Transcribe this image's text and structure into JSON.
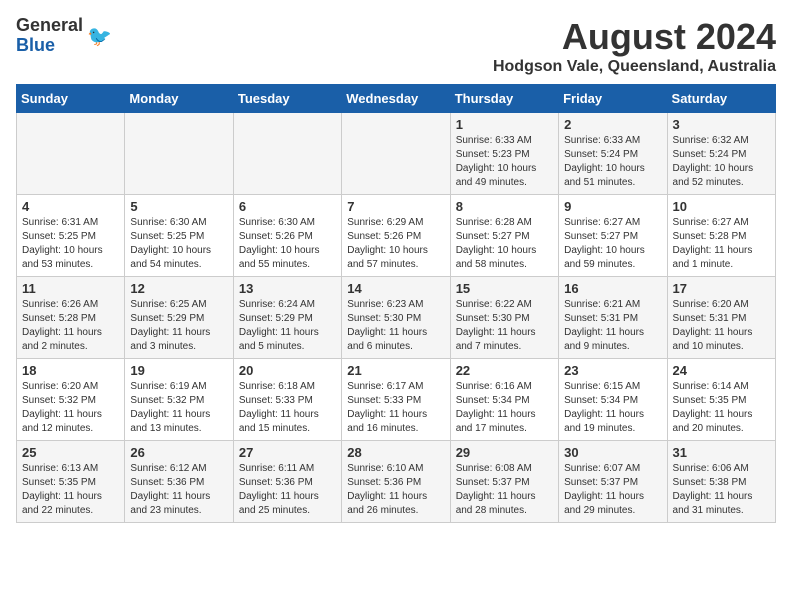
{
  "logo": {
    "general": "General",
    "blue": "Blue"
  },
  "title": "August 2024",
  "subtitle": "Hodgson Vale, Queensland, Australia",
  "days_of_week": [
    "Sunday",
    "Monday",
    "Tuesday",
    "Wednesday",
    "Thursday",
    "Friday",
    "Saturday"
  ],
  "weeks": [
    [
      {
        "day": "",
        "info": ""
      },
      {
        "day": "",
        "info": ""
      },
      {
        "day": "",
        "info": ""
      },
      {
        "day": "",
        "info": ""
      },
      {
        "day": "1",
        "info": "Sunrise: 6:33 AM\nSunset: 5:23 PM\nDaylight: 10 hours\nand 49 minutes."
      },
      {
        "day": "2",
        "info": "Sunrise: 6:33 AM\nSunset: 5:24 PM\nDaylight: 10 hours\nand 51 minutes."
      },
      {
        "day": "3",
        "info": "Sunrise: 6:32 AM\nSunset: 5:24 PM\nDaylight: 10 hours\nand 52 minutes."
      }
    ],
    [
      {
        "day": "4",
        "info": "Sunrise: 6:31 AM\nSunset: 5:25 PM\nDaylight: 10 hours\nand 53 minutes."
      },
      {
        "day": "5",
        "info": "Sunrise: 6:30 AM\nSunset: 5:25 PM\nDaylight: 10 hours\nand 54 minutes."
      },
      {
        "day": "6",
        "info": "Sunrise: 6:30 AM\nSunset: 5:26 PM\nDaylight: 10 hours\nand 55 minutes."
      },
      {
        "day": "7",
        "info": "Sunrise: 6:29 AM\nSunset: 5:26 PM\nDaylight: 10 hours\nand 57 minutes."
      },
      {
        "day": "8",
        "info": "Sunrise: 6:28 AM\nSunset: 5:27 PM\nDaylight: 10 hours\nand 58 minutes."
      },
      {
        "day": "9",
        "info": "Sunrise: 6:27 AM\nSunset: 5:27 PM\nDaylight: 10 hours\nand 59 minutes."
      },
      {
        "day": "10",
        "info": "Sunrise: 6:27 AM\nSunset: 5:28 PM\nDaylight: 11 hours\nand 1 minute."
      }
    ],
    [
      {
        "day": "11",
        "info": "Sunrise: 6:26 AM\nSunset: 5:28 PM\nDaylight: 11 hours\nand 2 minutes."
      },
      {
        "day": "12",
        "info": "Sunrise: 6:25 AM\nSunset: 5:29 PM\nDaylight: 11 hours\nand 3 minutes."
      },
      {
        "day": "13",
        "info": "Sunrise: 6:24 AM\nSunset: 5:29 PM\nDaylight: 11 hours\nand 5 minutes."
      },
      {
        "day": "14",
        "info": "Sunrise: 6:23 AM\nSunset: 5:30 PM\nDaylight: 11 hours\nand 6 minutes."
      },
      {
        "day": "15",
        "info": "Sunrise: 6:22 AM\nSunset: 5:30 PM\nDaylight: 11 hours\nand 7 minutes."
      },
      {
        "day": "16",
        "info": "Sunrise: 6:21 AM\nSunset: 5:31 PM\nDaylight: 11 hours\nand 9 minutes."
      },
      {
        "day": "17",
        "info": "Sunrise: 6:20 AM\nSunset: 5:31 PM\nDaylight: 11 hours\nand 10 minutes."
      }
    ],
    [
      {
        "day": "18",
        "info": "Sunrise: 6:20 AM\nSunset: 5:32 PM\nDaylight: 11 hours\nand 12 minutes."
      },
      {
        "day": "19",
        "info": "Sunrise: 6:19 AM\nSunset: 5:32 PM\nDaylight: 11 hours\nand 13 minutes."
      },
      {
        "day": "20",
        "info": "Sunrise: 6:18 AM\nSunset: 5:33 PM\nDaylight: 11 hours\nand 15 minutes."
      },
      {
        "day": "21",
        "info": "Sunrise: 6:17 AM\nSunset: 5:33 PM\nDaylight: 11 hours\nand 16 minutes."
      },
      {
        "day": "22",
        "info": "Sunrise: 6:16 AM\nSunset: 5:34 PM\nDaylight: 11 hours\nand 17 minutes."
      },
      {
        "day": "23",
        "info": "Sunrise: 6:15 AM\nSunset: 5:34 PM\nDaylight: 11 hours\nand 19 minutes."
      },
      {
        "day": "24",
        "info": "Sunrise: 6:14 AM\nSunset: 5:35 PM\nDaylight: 11 hours\nand 20 minutes."
      }
    ],
    [
      {
        "day": "25",
        "info": "Sunrise: 6:13 AM\nSunset: 5:35 PM\nDaylight: 11 hours\nand 22 minutes."
      },
      {
        "day": "26",
        "info": "Sunrise: 6:12 AM\nSunset: 5:36 PM\nDaylight: 11 hours\nand 23 minutes."
      },
      {
        "day": "27",
        "info": "Sunrise: 6:11 AM\nSunset: 5:36 PM\nDaylight: 11 hours\nand 25 minutes."
      },
      {
        "day": "28",
        "info": "Sunrise: 6:10 AM\nSunset: 5:36 PM\nDaylight: 11 hours\nand 26 minutes."
      },
      {
        "day": "29",
        "info": "Sunrise: 6:08 AM\nSunset: 5:37 PM\nDaylight: 11 hours\nand 28 minutes."
      },
      {
        "day": "30",
        "info": "Sunrise: 6:07 AM\nSunset: 5:37 PM\nDaylight: 11 hours\nand 29 minutes."
      },
      {
        "day": "31",
        "info": "Sunrise: 6:06 AM\nSunset: 5:38 PM\nDaylight: 11 hours\nand 31 minutes."
      }
    ]
  ]
}
